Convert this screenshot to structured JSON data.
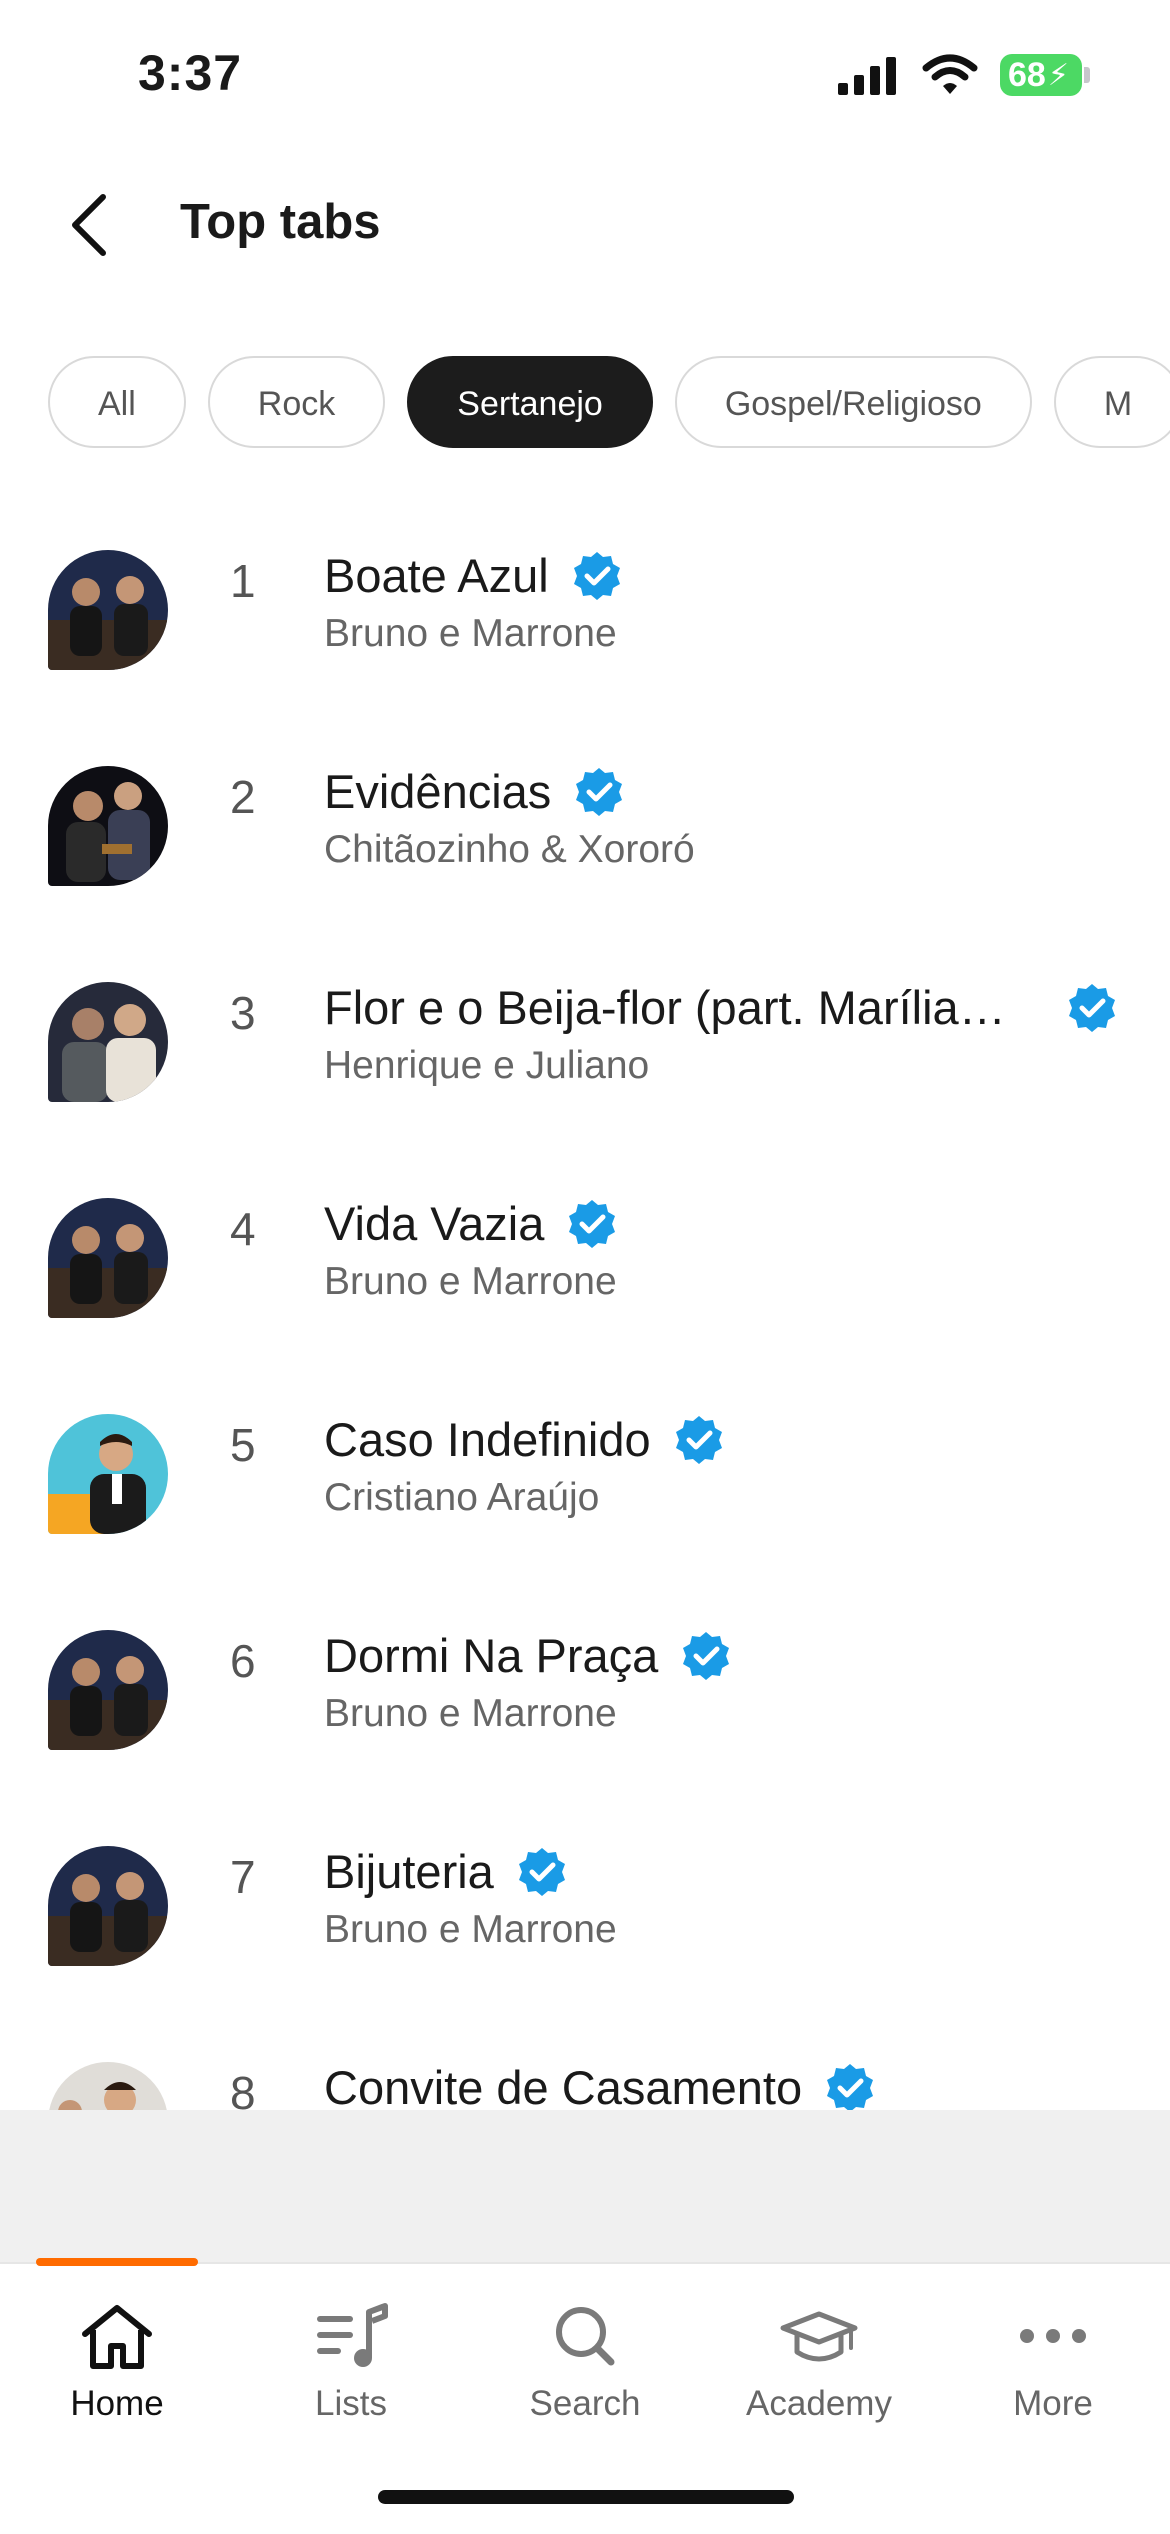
{
  "status_bar": {
    "time": "3:37",
    "battery": "68"
  },
  "header": {
    "title": "Top tabs"
  },
  "filters": {
    "chips": [
      {
        "label": "All",
        "active": false
      },
      {
        "label": "Rock",
        "active": false
      },
      {
        "label": "Sertanejo",
        "active": true
      },
      {
        "label": "Gospel/Religioso",
        "active": false
      },
      {
        "label": "M",
        "active": false
      }
    ]
  },
  "tabs": [
    {
      "rank": "1",
      "title": "Boate Azul",
      "artist": "Bruno e Marrone",
      "verified": true
    },
    {
      "rank": "2",
      "title": "Evidências",
      "artist": "Chitãozinho & Xororó",
      "verified": true
    },
    {
      "rank": "3",
      "title": "Flor e o Beija-flor (part. Marília …",
      "artist": "Henrique e Juliano",
      "verified": true
    },
    {
      "rank": "4",
      "title": "Vida Vazia",
      "artist": "Bruno e Marrone",
      "verified": true
    },
    {
      "rank": "5",
      "title": "Caso Indefinido",
      "artist": "Cristiano Araújo",
      "verified": true
    },
    {
      "rank": "6",
      "title": "Dormi Na Praça",
      "artist": "Bruno e Marrone",
      "verified": true
    },
    {
      "rank": "7",
      "title": "Bijuteria",
      "artist": "Bruno e Marrone",
      "verified": true
    },
    {
      "rank": "8",
      "title": "Convite de Casamento",
      "artist": "",
      "verified": true
    }
  ],
  "bottom_nav": {
    "items": [
      {
        "label": "Home",
        "icon": "home-icon",
        "active": true
      },
      {
        "label": "Lists",
        "icon": "list-music-icon",
        "active": false
      },
      {
        "label": "Search",
        "icon": "search-icon",
        "active": false
      },
      {
        "label": "Academy",
        "icon": "graduation-cap-icon",
        "active": false
      },
      {
        "label": "More",
        "icon": "more-dots-icon",
        "active": false
      }
    ]
  },
  "colors": {
    "accent": "#ff6b00",
    "verified": "#1a9be6",
    "chip_active": "#1c1c1c"
  }
}
